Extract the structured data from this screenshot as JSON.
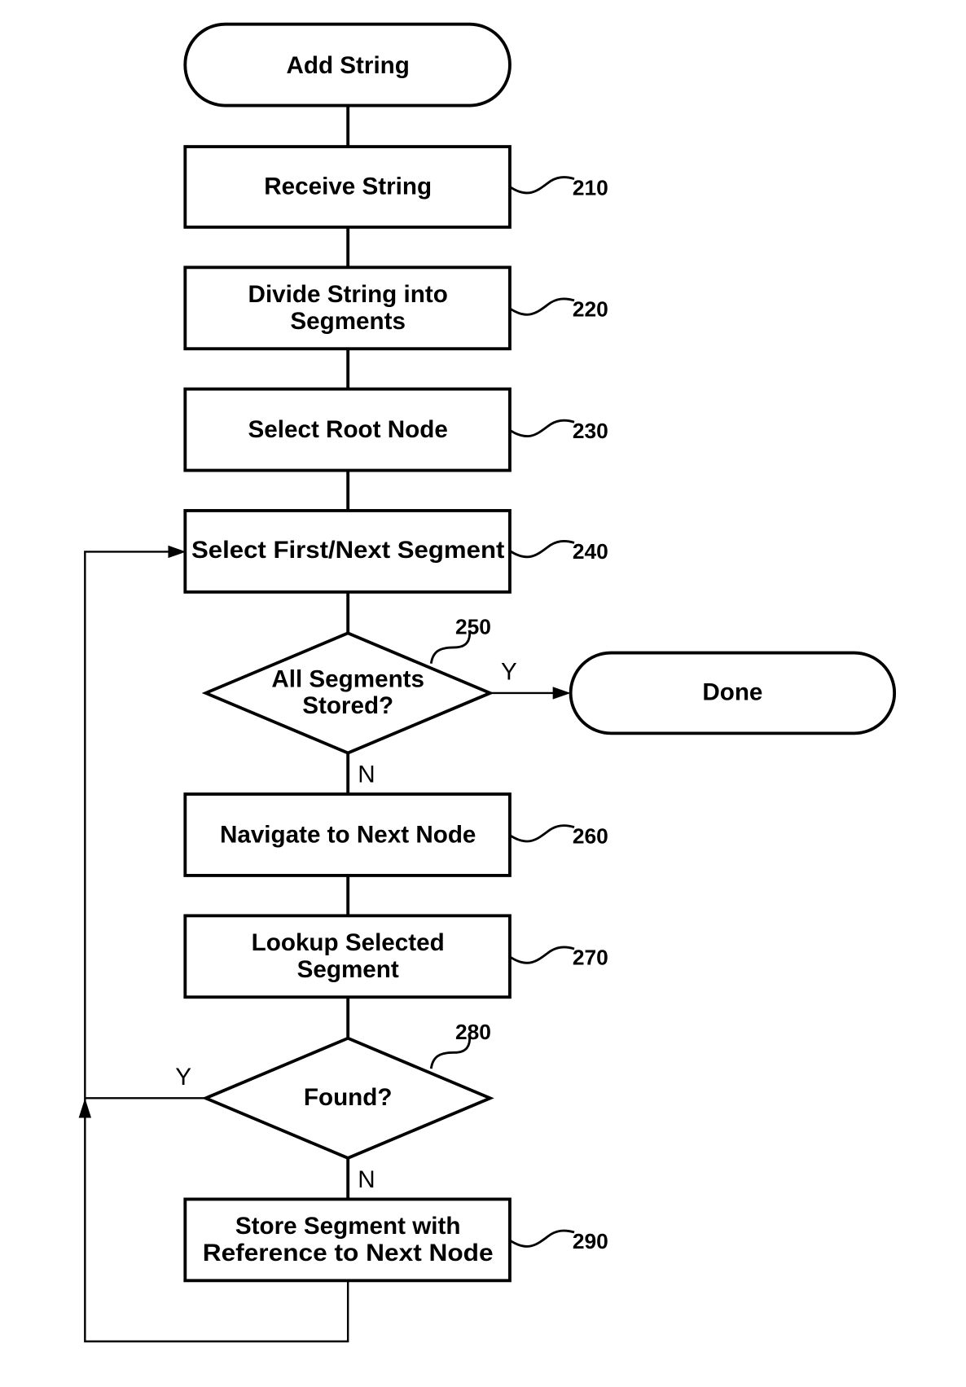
{
  "diagram": {
    "type": "flowchart",
    "nodes": [
      {
        "id": "start",
        "shape": "terminator",
        "lines": [
          "Add String"
        ]
      },
      {
        "id": "210",
        "shape": "process",
        "lines": [
          "Receive String"
        ],
        "ref": "210"
      },
      {
        "id": "220",
        "shape": "process",
        "lines": [
          "Divide String into",
          "Segments"
        ],
        "ref": "220"
      },
      {
        "id": "230",
        "shape": "process",
        "lines": [
          "Select Root Node"
        ],
        "ref": "230"
      },
      {
        "id": "240",
        "shape": "process",
        "lines": [
          "Select First/Next Segment"
        ],
        "ref": "240"
      },
      {
        "id": "250",
        "shape": "decision",
        "lines": [
          "All Segments",
          "Stored?"
        ],
        "ref": "250"
      },
      {
        "id": "done",
        "shape": "terminator",
        "lines": [
          "Done"
        ]
      },
      {
        "id": "260",
        "shape": "process",
        "lines": [
          "Navigate to Next Node"
        ],
        "ref": "260"
      },
      {
        "id": "270",
        "shape": "process",
        "lines": [
          "Lookup Selected",
          "Segment"
        ],
        "ref": "270"
      },
      {
        "id": "280",
        "shape": "decision",
        "lines": [
          "Found?"
        ],
        "ref": "280"
      },
      {
        "id": "290",
        "shape": "process",
        "lines": [
          "Store Segment with",
          "Reference to Next Node"
        ],
        "ref": "290"
      }
    ],
    "edges": [
      {
        "from": "start",
        "to": "210",
        "label": ""
      },
      {
        "from": "210",
        "to": "220",
        "label": ""
      },
      {
        "from": "220",
        "to": "230",
        "label": ""
      },
      {
        "from": "230",
        "to": "240",
        "label": ""
      },
      {
        "from": "240",
        "to": "250",
        "label": ""
      },
      {
        "from": "250",
        "to": "done",
        "label": "Y"
      },
      {
        "from": "250",
        "to": "260",
        "label": "N"
      },
      {
        "from": "260",
        "to": "270",
        "label": ""
      },
      {
        "from": "270",
        "to": "280",
        "label": ""
      },
      {
        "from": "280",
        "to": "240",
        "label": "Y"
      },
      {
        "from": "280",
        "to": "290",
        "label": "N"
      },
      {
        "from": "290",
        "to": "240",
        "label": ""
      }
    ]
  }
}
